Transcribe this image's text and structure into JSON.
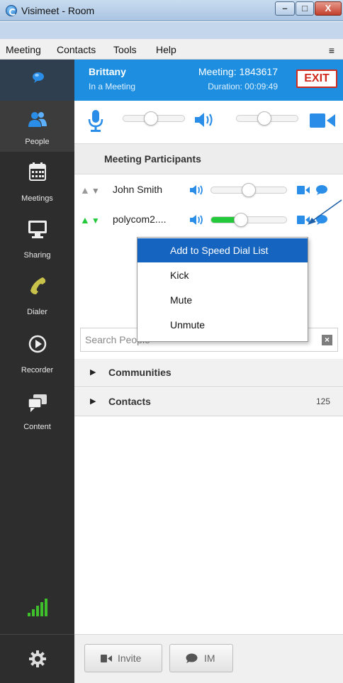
{
  "window": {
    "title": "Visimeet - Room",
    "min_glyph": "–",
    "max_glyph": "□",
    "close_glyph": "X"
  },
  "menu": {
    "items": [
      "Meeting",
      "Contacts",
      "Tools",
      "Help"
    ],
    "hamburger": "≡"
  },
  "sidebar": {
    "items": [
      {
        "label": "",
        "icon": "chat-bubble-icon"
      },
      {
        "label": "People",
        "icon": "people-icon"
      },
      {
        "label": "Meetings",
        "icon": "calendar-icon"
      },
      {
        "label": "Sharing",
        "icon": "monitor-icon"
      },
      {
        "label": "Dialer",
        "icon": "phone-icon"
      },
      {
        "label": "Recorder",
        "icon": "record-icon"
      },
      {
        "label": "Content",
        "icon": "content-chat-icon"
      }
    ],
    "signal_icon": "signal-bars-icon",
    "settings_icon": "gear-icon"
  },
  "call": {
    "user": "Brittany",
    "status": "In a Meeting",
    "meeting_label": "Meeting:",
    "meeting_id": "1843617",
    "duration_label": "Duration:",
    "duration": "00:09:49",
    "exit_label": "EXIT"
  },
  "controls": {
    "mic_level": 0.45,
    "speaker_level": 0.45
  },
  "participants": {
    "header": "Meeting Participants",
    "rows": [
      {
        "name": "John Smith",
        "volume": 0.5,
        "active": false
      },
      {
        "name": "polycom2....",
        "volume": 0.4,
        "active": true
      }
    ]
  },
  "context_menu": {
    "items": [
      "Add to Speed Dial List",
      "Kick",
      "Mute",
      "Unmute"
    ],
    "highlighted": 0
  },
  "search": {
    "placeholder": "Search People",
    "clear_glyph": "×"
  },
  "groups": [
    {
      "label": "Communities",
      "count": ""
    },
    {
      "label": "Contacts",
      "count": "125"
    }
  ],
  "bottom": {
    "invite_label": "Invite",
    "im_label": "IM"
  },
  "colors": {
    "accent": "#1e8fe0",
    "exit": "#d12a1f",
    "active_green": "#22c93a",
    "sidebar": "#2d2d2d"
  }
}
